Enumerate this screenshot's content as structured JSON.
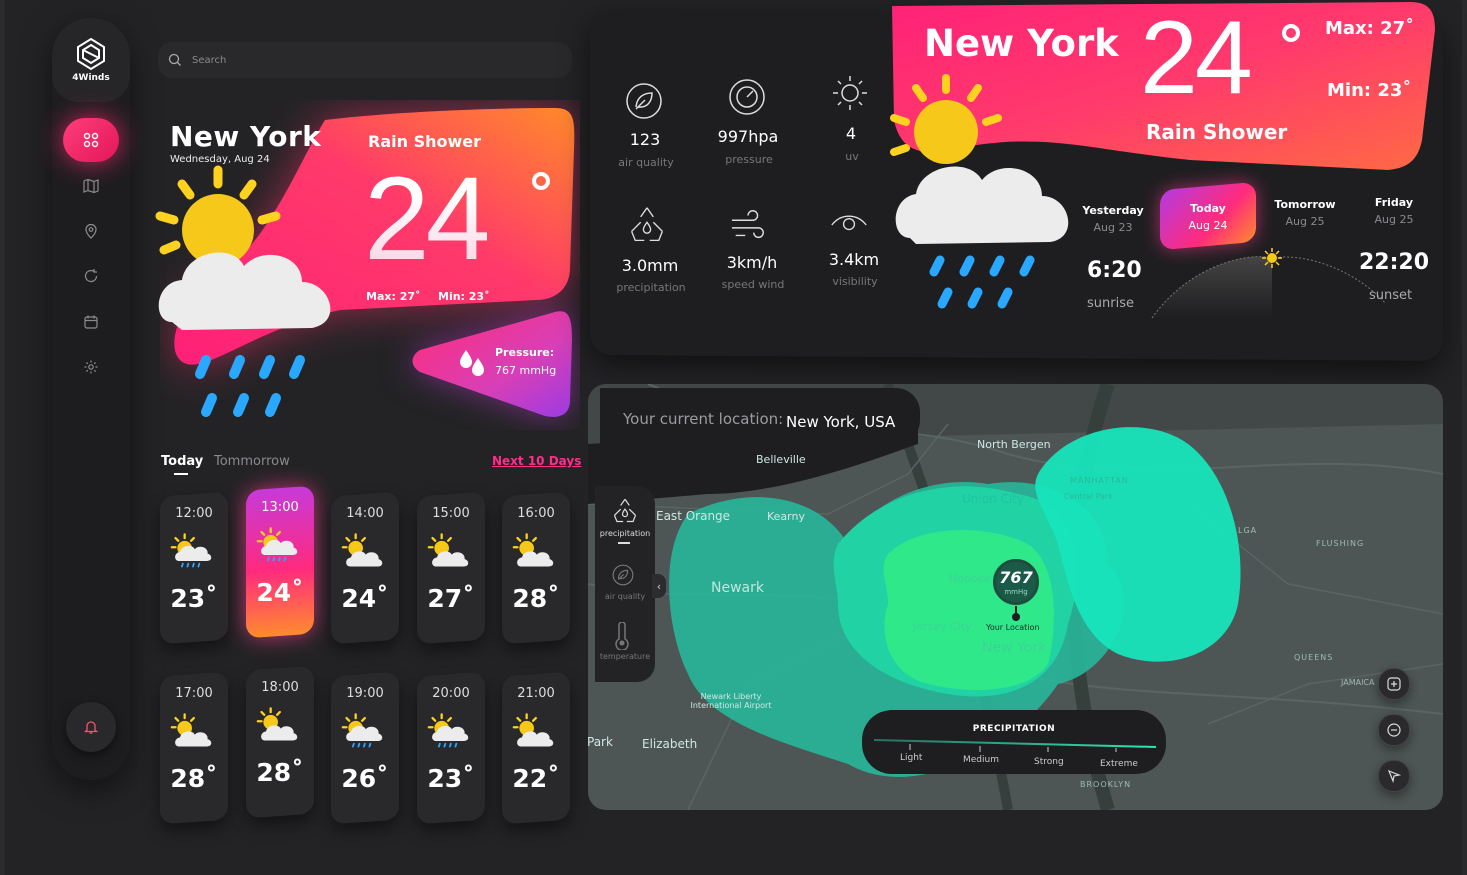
{
  "app": {
    "logo_label": "4Winds"
  },
  "search": {
    "placeholder": "Search"
  },
  "current": {
    "city": "New York",
    "date": "Wednesday, Aug 24",
    "condition": "Rain Shower",
    "temp": "24",
    "max": "Max: 27˚",
    "min": "Min: 23˚",
    "pressure_label": "Pressure:",
    "pressure_value": "767   mmHg"
  },
  "forecast_tabs": {
    "today": "Today",
    "tomorrow": "Tommorrow",
    "next": "Next 10 Days"
  },
  "hourly": [
    {
      "time": "12:00",
      "temp": "23˚",
      "icon": "rain-cloud-sun-icon"
    },
    {
      "time": "13:00",
      "temp": "24˚",
      "icon": "rain-cloud-sun-icon",
      "active": true
    },
    {
      "time": "14:00",
      "temp": "24˚",
      "icon": "cloud-sun-icon"
    },
    {
      "time": "15:00",
      "temp": "27˚",
      "icon": "cloud-sun-icon"
    },
    {
      "time": "16:00",
      "temp": "28˚",
      "icon": "cloud-sun-icon"
    },
    {
      "time": "17:00",
      "temp": "28˚",
      "icon": "cloud-sun-icon"
    },
    {
      "time": "18:00",
      "temp": "28˚",
      "icon": "cloud-sun-icon"
    },
    {
      "time": "19:00",
      "temp": "26˚",
      "icon": "rain-cloud-sun-icon"
    },
    {
      "time": "20:00",
      "temp": "23˚",
      "icon": "rain-cloud-sun-icon"
    },
    {
      "time": "21:00",
      "temp": "22˚",
      "icon": "cloud-sun-icon"
    }
  ],
  "stats": {
    "air_quality": {
      "value": "123",
      "label": "air quality"
    },
    "pressure": {
      "value": "997hpa",
      "label": "pressure"
    },
    "uv": {
      "value": "4",
      "label": "uv"
    },
    "precipitation": {
      "value": "3.0mm",
      "label": "precipitation"
    },
    "wind": {
      "value": "3km/h",
      "label": "speed wind"
    },
    "visibility": {
      "value": "3.4km",
      "label": "visibility"
    }
  },
  "banner": {
    "city": "New York",
    "temp": "24",
    "max": "Max: 27˚",
    "min": "Min: 23˚",
    "condition": "Rain Shower"
  },
  "days": {
    "yesterday": {
      "name": "Yesterday",
      "date": "Aug 23"
    },
    "today": {
      "name": "Today",
      "date": "Aug 24"
    },
    "tomorrow": {
      "name": "Tomorrow",
      "date": "Aug 25"
    },
    "friday": {
      "name": "Friday",
      "date": "Aug 25"
    }
  },
  "sun": {
    "sunrise_time": "6:20",
    "sunrise_label": "sunrise",
    "sunset_time": "22:20",
    "sunset_label": "sunset"
  },
  "map": {
    "location_label": "Your current location:",
    "location_value": "New York, USA",
    "marker_value": "767",
    "marker_unit": "mmHg",
    "marker_label": "Your Location",
    "layers": [
      "precipitation",
      "air quality",
      "temperature"
    ],
    "legend_title": "PRECIPITATION",
    "legend_levels": [
      "Light",
      "Medium",
      "Strong",
      "Extreme"
    ],
    "places": {
      "belleville": "Belleville",
      "north_bergen": "North Bergen",
      "east_orange": "East Orange",
      "kearny": "Kearny",
      "union_city": "Union City",
      "manhattan": "MANHATTAN",
      "central_park": "Central Park",
      "lga": "LGA",
      "flushing": "FLUSHING",
      "newark": "Newark",
      "hoboken": "Hoboken",
      "jersey_city": "Jersey City",
      "new_york": "New York",
      "queens": "QUEENS",
      "jamaica": "JAMAICA",
      "newark_airport": "Newark Liberty International Airport",
      "park": "Park",
      "elizabeth": "Elizabeth",
      "brooklyn": "BROOKLYN"
    }
  },
  "colors": {
    "accent_pink": "#ff2e7a",
    "accent_orange": "#ff8a2d",
    "accent_purple": "#b33be0",
    "map_teal": "#27c9a8",
    "map_green": "#2ee88a"
  }
}
